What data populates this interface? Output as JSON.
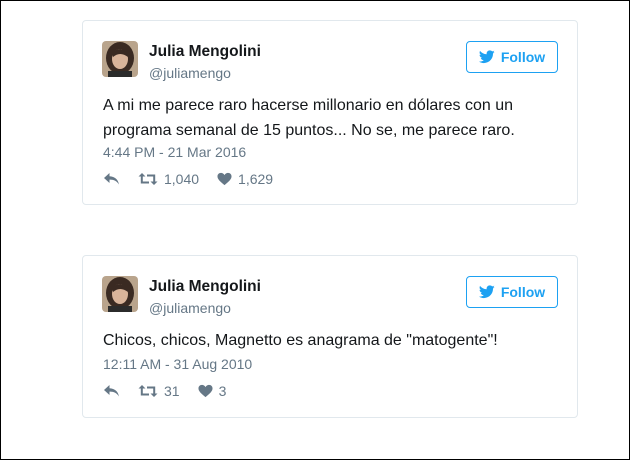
{
  "tweets": [
    {
      "author_name": "Julia Mengolini",
      "author_handle": "@juliamengo",
      "follow_label": "Follow",
      "text": "A mi me parece raro hacerse millonario en dólares con un programa semanal de 15 puntos... No se, me parece raro.",
      "timestamp": "4:44 PM - 21 Mar 2016",
      "retweets": "1,040",
      "likes": "1,629"
    },
    {
      "author_name": "Julia Mengolini",
      "author_handle": "@juliamengo",
      "follow_label": "Follow",
      "text": "Chicos, chicos, Magnetto es anagrama de \"matogente\"!",
      "timestamp": "12:11 AM - 31 Aug 2010",
      "retweets": "31",
      "likes": "3"
    }
  ],
  "colors": {
    "accent": "#1da1f2",
    "text": "#14171a",
    "muted": "#657786",
    "card_border": "#e1e8ed"
  },
  "icons": {
    "follow": "twitter-bird-icon",
    "reply": "reply-icon",
    "retweet": "retweet-icon",
    "like": "heart-icon"
  }
}
